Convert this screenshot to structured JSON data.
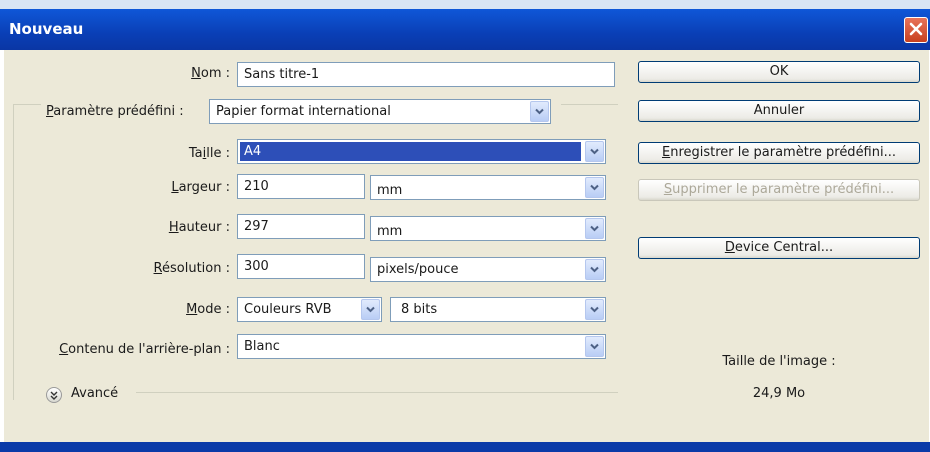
{
  "window": {
    "title": "Nouveau"
  },
  "form": {
    "nom": {
      "label_pre": "",
      "label_u": "N",
      "label_post": "om :",
      "value": "Sans titre-1"
    },
    "preset": {
      "label_pre": "",
      "label_u": "P",
      "label_post": "aramètre prédéfini :",
      "value": "Papier format international"
    },
    "taille": {
      "label_pre": "Ta",
      "label_u": "i",
      "label_post": "lle :",
      "value": "A4"
    },
    "largeur": {
      "label_pre": "",
      "label_u": "L",
      "label_post": "argeur :",
      "value": "210",
      "unit": "mm"
    },
    "hauteur": {
      "label_pre": "",
      "label_u": "H",
      "label_post": "auteur :",
      "value": "297",
      "unit": "mm"
    },
    "resolution": {
      "label_pre": "",
      "label_u": "R",
      "label_post": "ésolution :",
      "value": "300",
      "unit": "pixels/pouce"
    },
    "mode": {
      "label_pre": "",
      "label_u": "M",
      "label_post": "ode :",
      "value": "Couleurs RVB",
      "depth": "8 bits"
    },
    "background": {
      "label_pre": "",
      "label_u": "C",
      "label_post": "ontenu de l'arrière-plan :",
      "value": "Blanc"
    },
    "advanced": {
      "label": "Avancé"
    }
  },
  "buttons": {
    "ok": "OK",
    "cancel": "Annuler",
    "save_preset_u": "E",
    "save_preset_rest": "nregistrer le paramètre prédéfini...",
    "delete_preset_u": "S",
    "delete_preset_rest": "upprimer le paramètre prédéfini...",
    "device_central_pre": "",
    "device_central_u": "D",
    "device_central_post": "evice Central..."
  },
  "image_size": {
    "label": "Taille de l'image :",
    "value": "24,9 Mo"
  },
  "colors": {
    "titlebar": "#0a3fb6",
    "dialog_bg": "#ece9d8",
    "selection": "#2d4fb8"
  }
}
